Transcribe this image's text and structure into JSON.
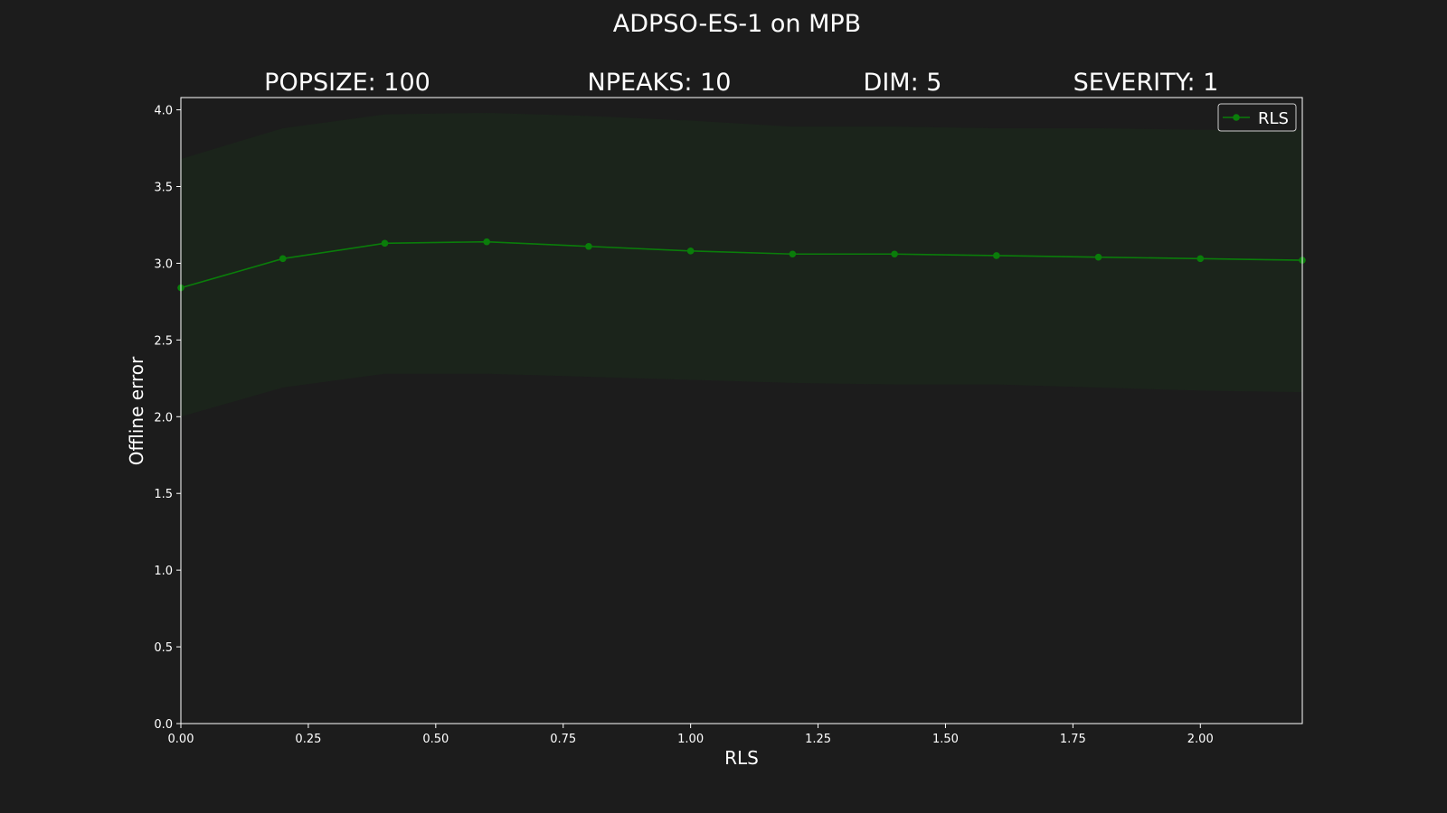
{
  "colors": {
    "background": "#1c1c1c",
    "series": "#0a7d0a",
    "band": "#1b241b",
    "axis": "#ffffff",
    "text": "#ffffff"
  },
  "chart_data": {
    "type": "line",
    "title": "ADPSO-ES-1 on MPB",
    "subtitles": [
      "POPSIZE: 100",
      "NPEAKS: 10",
      "DIM: 5",
      "SEVERITY: 1"
    ],
    "xlabel": "RLS",
    "ylabel": "Offline error",
    "xlim": [
      0,
      2.2
    ],
    "ylim": [
      0,
      4.08
    ],
    "xticks": [
      "0.00",
      "0.25",
      "0.50",
      "0.75",
      "1.00",
      "1.25",
      "1.50",
      "1.75",
      "2.00"
    ],
    "yticks": [
      "0.0",
      "0.5",
      "1.0",
      "1.5",
      "2.0",
      "2.5",
      "3.0",
      "3.5",
      "4.0"
    ],
    "grid": false,
    "legend_position": "top-right",
    "series": [
      {
        "name": "RLS",
        "x": [
          0.0,
          0.2,
          0.4,
          0.6,
          0.8,
          1.0,
          1.2,
          1.4,
          1.6,
          1.8,
          2.0,
          2.2
        ],
        "y": [
          2.84,
          3.03,
          3.13,
          3.14,
          3.11,
          3.08,
          3.06,
          3.06,
          3.05,
          3.04,
          3.03,
          3.02
        ],
        "upper": [
          3.68,
          3.88,
          3.97,
          3.98,
          3.96,
          3.93,
          3.89,
          3.89,
          3.88,
          3.88,
          3.87,
          3.87
        ],
        "lower": [
          2.0,
          2.19,
          2.28,
          2.28,
          2.26,
          2.24,
          2.22,
          2.21,
          2.21,
          2.19,
          2.17,
          2.16
        ]
      }
    ]
  }
}
